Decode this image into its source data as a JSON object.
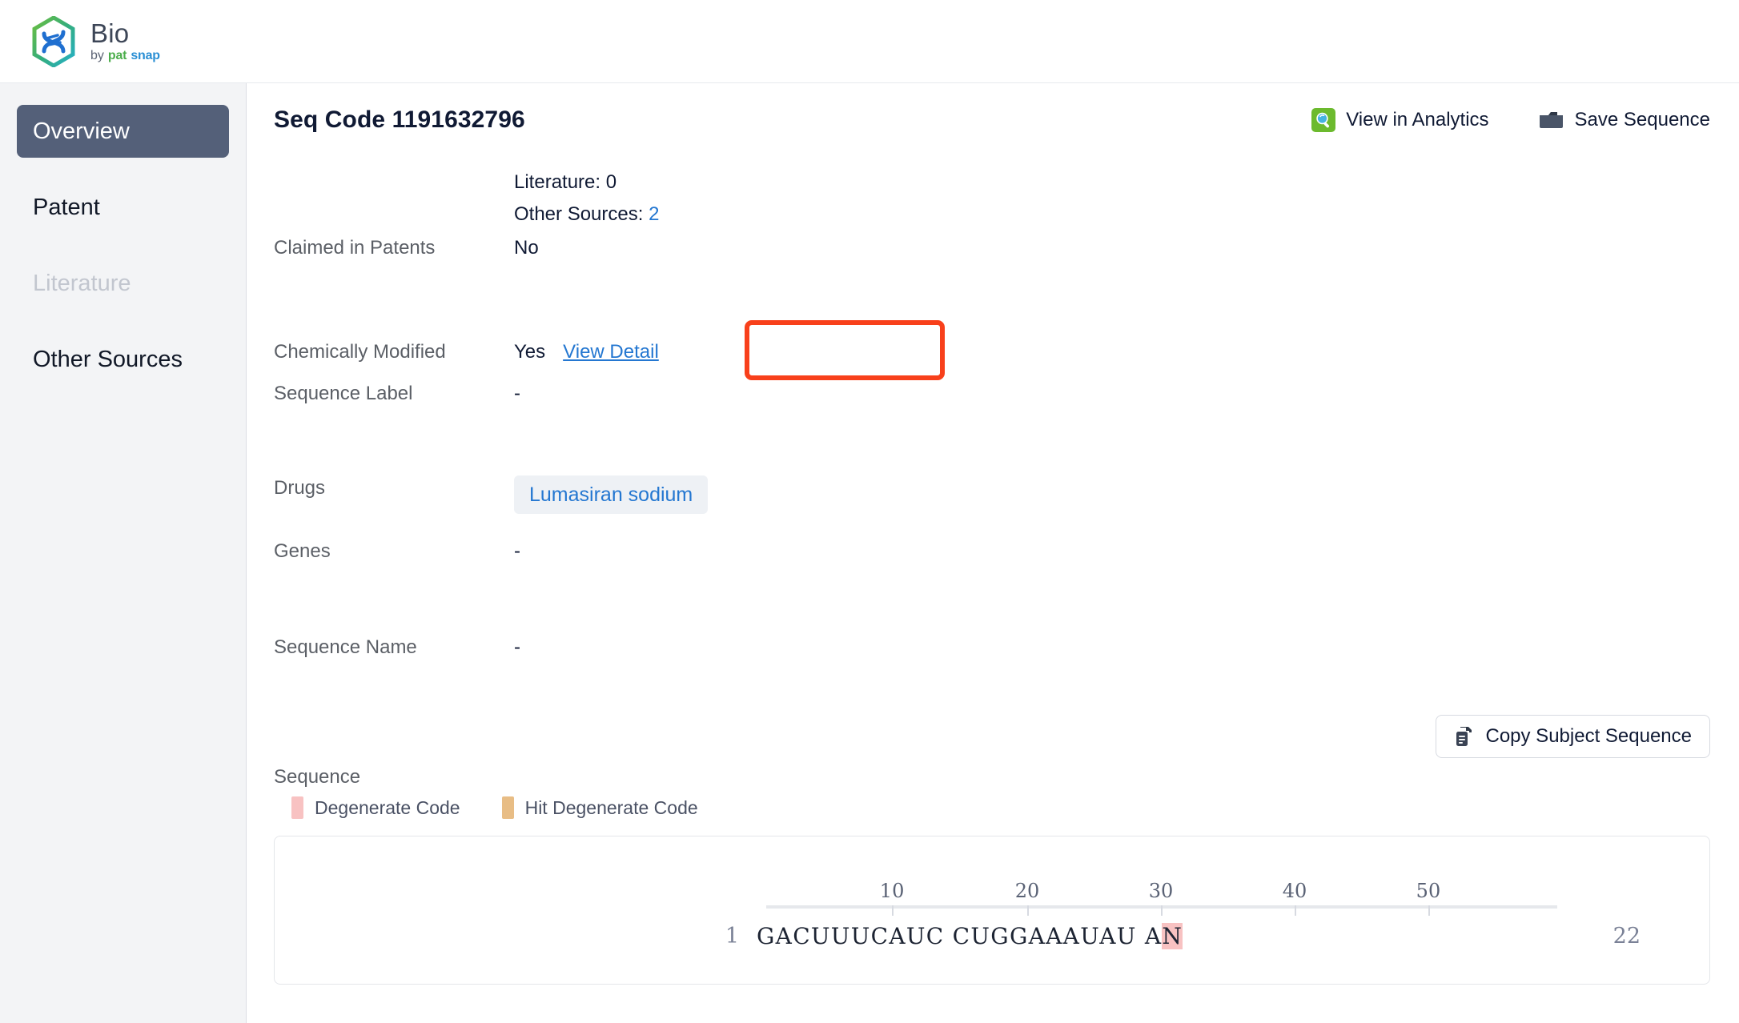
{
  "brand": {
    "title": "Bio",
    "by": "by",
    "pat": "pat",
    "snap": "snap",
    "logo_icon": "dna-hexagon-logo"
  },
  "sidebar": {
    "items": [
      {
        "label": "Overview",
        "state": "active"
      },
      {
        "label": "Patent",
        "state": "default"
      },
      {
        "label": "Literature",
        "state": "disabled"
      },
      {
        "label": "Other Sources",
        "state": "default"
      }
    ]
  },
  "header": {
    "title": "Seq Code 1191632796",
    "actions": [
      {
        "label": "View in Analytics",
        "icon": "analytics-search-icon"
      },
      {
        "label": "Save Sequence",
        "icon": "folder-icon"
      }
    ]
  },
  "details": {
    "counts": {
      "literature_label": "Literature: 0",
      "other_sources_label": "Other Sources:",
      "other_sources_value": "2"
    },
    "claimed_in_patents": {
      "label": "Claimed in Patents",
      "value": "No"
    },
    "chemically_modified": {
      "label": "Chemically Modified",
      "value": "Yes",
      "link": "View Detail",
      "highlight_color": "#f8401b"
    },
    "sequence_label": {
      "label": "Sequence Label",
      "value": "-"
    },
    "drugs": {
      "label": "Drugs",
      "chips": [
        "Lumasiran sodium"
      ]
    },
    "genes": {
      "label": "Genes",
      "value": "-"
    },
    "sequence_name": {
      "label": "Sequence Name",
      "value": "-"
    }
  },
  "sequence_section": {
    "label": "Sequence",
    "copy_button": {
      "label": "Copy Subject Sequence",
      "icon": "copy-icon"
    },
    "legend": [
      {
        "label": "Degenerate Code",
        "color": "#f8c2c2"
      },
      {
        "label": "Hit Degenerate Code",
        "color": "#e8bd85"
      }
    ],
    "viewer": {
      "ruler_ticks": [
        "10",
        "20",
        "30",
        "40",
        "50"
      ],
      "start_position": "1",
      "end_position": "22",
      "residues_plain_1": "GACUUUCAUC CUGGAAAUAU A",
      "residues_degenerate": "N",
      "full_sequence": "GACUUUCAUC CUGGAAAUAU AN"
    }
  },
  "colors": {
    "accent_link": "#2477d1",
    "sidebar_active": "#546079",
    "sidebar_bg": "#f3f4f6",
    "annotation_red": "#f8401b"
  }
}
